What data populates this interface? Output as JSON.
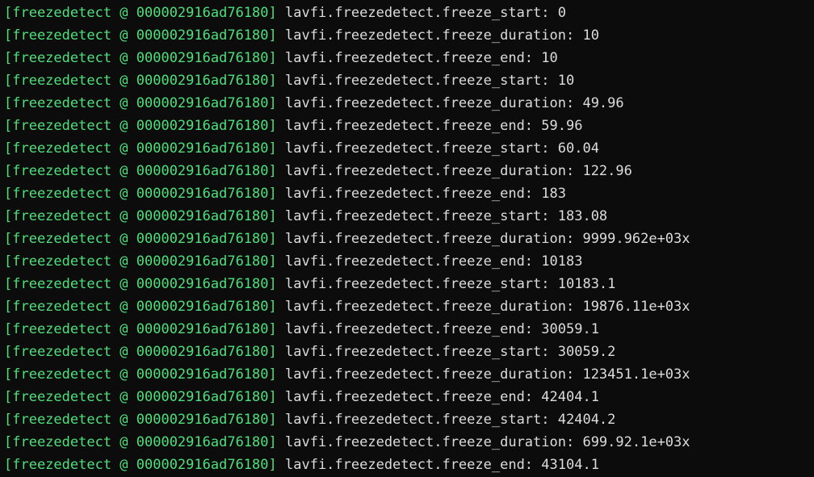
{
  "colors": {
    "background": "#0c0c0c",
    "tag": "#4ee07a",
    "text": "#dcdcdc"
  },
  "terminal": {
    "lines": [
      {
        "tag": "[freezedetect @ 000002916ad76180]",
        "message": " lavfi.freezedetect.freeze_start: 0"
      },
      {
        "tag": "[freezedetect @ 000002916ad76180]",
        "message": " lavfi.freezedetect.freeze_duration: 10"
      },
      {
        "tag": "[freezedetect @ 000002916ad76180]",
        "message": " lavfi.freezedetect.freeze_end: 10"
      },
      {
        "tag": "[freezedetect @ 000002916ad76180]",
        "message": " lavfi.freezedetect.freeze_start: 10"
      },
      {
        "tag": "[freezedetect @ 000002916ad76180]",
        "message": " lavfi.freezedetect.freeze_duration: 49.96"
      },
      {
        "tag": "[freezedetect @ 000002916ad76180]",
        "message": " lavfi.freezedetect.freeze_end: 59.96"
      },
      {
        "tag": "[freezedetect @ 000002916ad76180]",
        "message": " lavfi.freezedetect.freeze_start: 60.04"
      },
      {
        "tag": "[freezedetect @ 000002916ad76180]",
        "message": " lavfi.freezedetect.freeze_duration: 122.96"
      },
      {
        "tag": "[freezedetect @ 000002916ad76180]",
        "message": " lavfi.freezedetect.freeze_end: 183"
      },
      {
        "tag": "[freezedetect @ 000002916ad76180]",
        "message": " lavfi.freezedetect.freeze_start: 183.08"
      },
      {
        "tag": "[freezedetect @ 000002916ad76180]",
        "message": " lavfi.freezedetect.freeze_duration: 9999.962e+03x"
      },
      {
        "tag": "[freezedetect @ 000002916ad76180]",
        "message": " lavfi.freezedetect.freeze_end: 10183"
      },
      {
        "tag": "[freezedetect @ 000002916ad76180]",
        "message": " lavfi.freezedetect.freeze_start: 10183.1"
      },
      {
        "tag": "[freezedetect @ 000002916ad76180]",
        "message": " lavfi.freezedetect.freeze_duration: 19876.11e+03x"
      },
      {
        "tag": "[freezedetect @ 000002916ad76180]",
        "message": " lavfi.freezedetect.freeze_end: 30059.1"
      },
      {
        "tag": "[freezedetect @ 000002916ad76180]",
        "message": " lavfi.freezedetect.freeze_start: 30059.2"
      },
      {
        "tag": "[freezedetect @ 000002916ad76180]",
        "message": " lavfi.freezedetect.freeze_duration: 123451.1e+03x"
      },
      {
        "tag": "[freezedetect @ 000002916ad76180]",
        "message": " lavfi.freezedetect.freeze_end: 42404.1"
      },
      {
        "tag": "[freezedetect @ 000002916ad76180]",
        "message": " lavfi.freezedetect.freeze_start: 42404.2"
      },
      {
        "tag": "[freezedetect @ 000002916ad76180]",
        "message": " lavfi.freezedetect.freeze_duration: 699.92.1e+03x"
      },
      {
        "tag": "[freezedetect @ 000002916ad76180]",
        "message": " lavfi.freezedetect.freeze_end: 43104.1"
      }
    ]
  }
}
